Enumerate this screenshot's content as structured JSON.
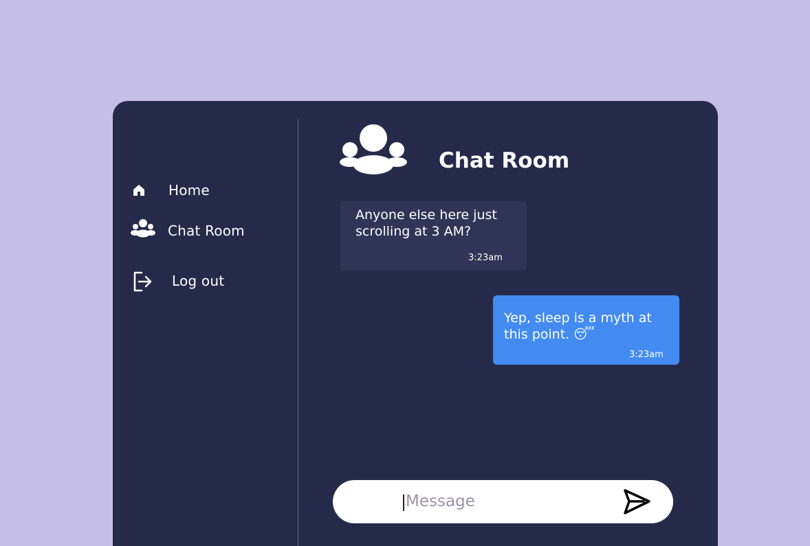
{
  "sidebar": {
    "items": [
      {
        "label": "Home",
        "icon": "home-icon"
      },
      {
        "label": "Chat Room",
        "icon": "users-icon"
      },
      {
        "label": "Log out",
        "icon": "logout-icon"
      }
    ]
  },
  "chat": {
    "title": "Chat Room",
    "header_icon": "users-icon",
    "messages": [
      {
        "direction": "incoming",
        "text": "Anyone else here just scrolling at 3 AM?",
        "time": "3:23am"
      },
      {
        "direction": "outgoing",
        "text": "Yep, sleep is a myth at this point. 😴",
        "time": "3:23am"
      }
    ]
  },
  "composer": {
    "value": "",
    "placeholder": "Message",
    "send_icon": "send-icon"
  },
  "colors": {
    "page_background": "#c5bee6",
    "panel": "#262a4a",
    "incoming_bubble": "#303456",
    "outgoing_bubble": "#438bf0",
    "text": "#ffffff"
  }
}
